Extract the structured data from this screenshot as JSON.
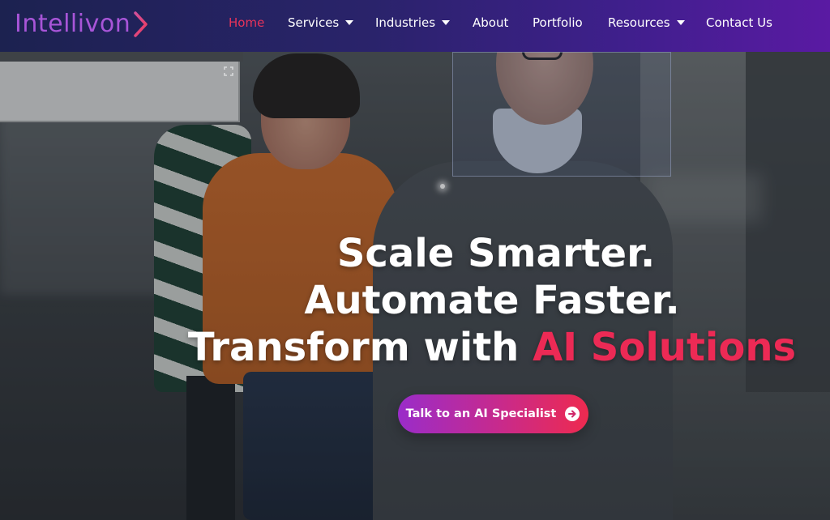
{
  "brand": {
    "name": "Intellivon",
    "color": "#a855d8"
  },
  "nav": {
    "items": [
      {
        "label": "Home",
        "active": true,
        "dropdown": false
      },
      {
        "label": "Services",
        "active": false,
        "dropdown": true
      },
      {
        "label": "Industries",
        "active": false,
        "dropdown": true
      },
      {
        "label": "About",
        "active": false,
        "dropdown": false
      },
      {
        "label": "Portfolio",
        "active": false,
        "dropdown": false
      },
      {
        "label": "Resources",
        "active": false,
        "dropdown": true
      },
      {
        "label": "Contact Us",
        "active": false,
        "dropdown": false
      }
    ],
    "active_color": "#e8335a"
  },
  "hero": {
    "headline_line1": "Scale Smarter.",
    "headline_line2": "Automate Faster.",
    "headline_line3_prefix": "Transform with ",
    "headline_line3_accent": "AI Solutions",
    "accent_color": "#ec2a55",
    "cta_label": "Talk to an AI Specialist",
    "cta_icon": "arrow-right-circle-icon"
  },
  "icons": {
    "expand": "expand-icon",
    "caret": "chevron-down-icon"
  }
}
